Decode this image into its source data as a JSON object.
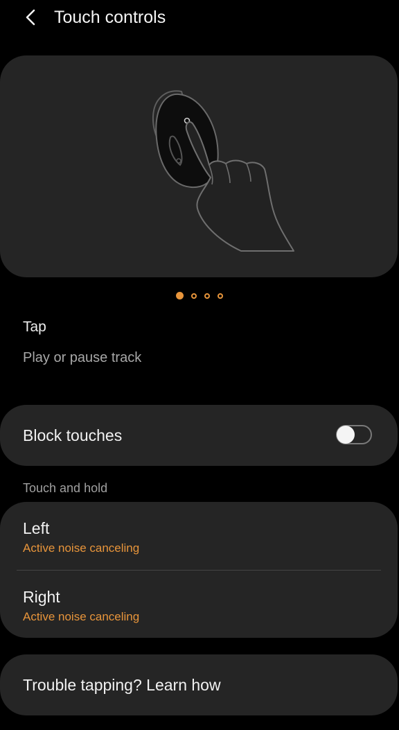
{
  "header": {
    "title": "Touch controls",
    "back_icon": "chevron-left-icon"
  },
  "illustration": {
    "subject": "earbud-touch-illustration",
    "page_count": 4,
    "active_page": 1
  },
  "gesture": {
    "title": "Tap",
    "description": "Play or pause track"
  },
  "block_touches": {
    "label": "Block touches",
    "enabled": false
  },
  "touch_and_hold": {
    "section_label": "Touch and hold",
    "items": [
      {
        "title": "Left",
        "value": "Active noise canceling"
      },
      {
        "title": "Right",
        "value": "Active noise canceling"
      }
    ]
  },
  "help": {
    "label": "Trouble tapping? Learn how"
  },
  "colors": {
    "accent": "#e8953b",
    "background": "#000000",
    "card": "#252525"
  }
}
